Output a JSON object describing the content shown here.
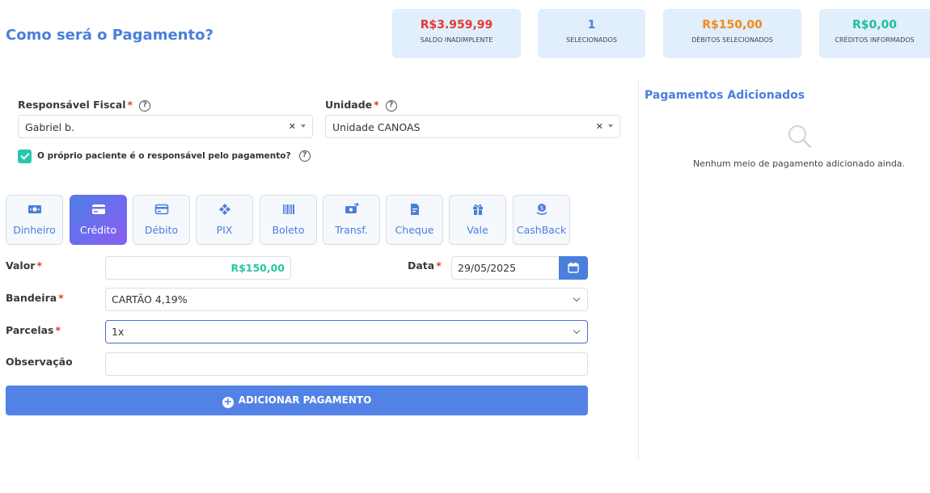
{
  "header": {
    "title": "Como será o Pagamento?"
  },
  "stats": [
    {
      "value": "R$3.959,99",
      "label": "SALDO INADIMPLENTE",
      "color": "#e53935"
    },
    {
      "value": "1",
      "label": "SELECIONADOS",
      "color": "#4a7fdc"
    },
    {
      "value": "R$150,00",
      "label": "DÉBITOS SELECIONADOS",
      "color": "#f28a1e"
    },
    {
      "value": "R$0,00",
      "label": "CRÉDITOS INFORMADOS",
      "color": "#1fbf9a"
    }
  ],
  "responsavel": {
    "label": "Responsável Fiscal",
    "value": "Gabriel b."
  },
  "unidade": {
    "label": "Unidade",
    "value": "Unidade CANOAS"
  },
  "required_mark": "*",
  "help_glyph": "?",
  "checkbox": {
    "label": "O próprio paciente é o responsável pelo pagamento?",
    "checked": true
  },
  "methods": [
    {
      "label": "Dinheiro",
      "icon": "money-icon"
    },
    {
      "label": "Crédito",
      "icon": "credit-card-icon",
      "active": true
    },
    {
      "label": "Débito",
      "icon": "debit-card-icon"
    },
    {
      "label": "PIX",
      "icon": "pix-icon"
    },
    {
      "label": "Boleto",
      "icon": "barcode-icon"
    },
    {
      "label": "Transf.",
      "icon": "transfer-icon"
    },
    {
      "label": "Cheque",
      "icon": "cheque-icon"
    },
    {
      "label": "Vale",
      "icon": "gift-icon"
    },
    {
      "label": "CashBack",
      "icon": "cashback-icon"
    }
  ],
  "form": {
    "valor_label": "Valor",
    "valor": "R$150,00",
    "data_label": "Data",
    "data": "29/05/2025",
    "bandeira_label": "Bandeira",
    "bandeira": "CARTÃO 4,19%",
    "parcelas_label": "Parcelas",
    "parcelas": "1x",
    "observacao_label": "Observação",
    "observacao": ""
  },
  "add_button": {
    "label": "ADICIONAR PAGAMENTO",
    "plus": "+"
  },
  "sidebar": {
    "title": "Pagamentos Adicionados",
    "empty_text": "Nenhum meio de pagamento adicionado ainda."
  },
  "colors": {
    "accent": "#4a7fdc",
    "teal": "#26c6b0",
    "card_bg": "#e1eefc"
  }
}
